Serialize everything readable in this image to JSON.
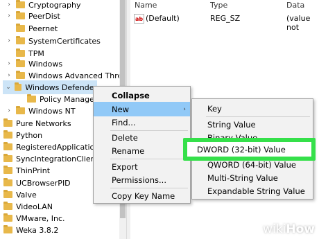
{
  "tree": {
    "items": [
      {
        "label": "Cryptography",
        "expandable": true
      },
      {
        "label": "PeerDist",
        "expandable": true
      },
      {
        "label": "Peernet",
        "expandable": false
      },
      {
        "label": "SystemCertificates",
        "expandable": true
      },
      {
        "label": "TPM",
        "expandable": false
      },
      {
        "label": "Windows",
        "expandable": true
      },
      {
        "label": "Windows Advanced Threat",
        "expandable": true
      },
      {
        "label": "Windows Defender",
        "expandable": true,
        "expanded": true
      },
      {
        "label": "Policy Manager",
        "expandable": false
      },
      {
        "label": "Windows NT",
        "expandable": true
      },
      {
        "label": "Pure Networks",
        "expandable": true
      },
      {
        "label": "Python",
        "expandable": true
      },
      {
        "label": "RegisteredApplications",
        "expandable": false
      },
      {
        "label": "SyncIntegrationClients",
        "expandable": true
      },
      {
        "label": "ThinPrint",
        "expandable": true
      },
      {
        "label": "UCBrowserPID",
        "expandable": false
      },
      {
        "label": "Valve",
        "expandable": true
      },
      {
        "label": "VideoLAN",
        "expandable": true
      },
      {
        "label": "VMware, Inc.",
        "expandable": true
      },
      {
        "label": "Weka 3.8.2",
        "expandable": true
      }
    ]
  },
  "list": {
    "columns": {
      "name": "Name",
      "type": "Type",
      "data": "Data"
    },
    "rows": [
      {
        "name": "(Default)",
        "type": "REG_SZ",
        "data": "(value not"
      }
    ]
  },
  "context_menu": {
    "items": [
      "Collapse",
      "New",
      "Find...",
      "Delete",
      "Rename",
      "Export",
      "Permissions...",
      "Copy Key Name"
    ]
  },
  "submenu": {
    "items": [
      "Key",
      "String Value",
      "Binary Value",
      "DWORD (32-bit) Value",
      "QWORD (64-bit) Value",
      "Multi-String Value",
      "Expandable String Value"
    ]
  },
  "highlight_color": "#35e04a",
  "watermark": {
    "part1": "wiki",
    "part2": "How"
  }
}
